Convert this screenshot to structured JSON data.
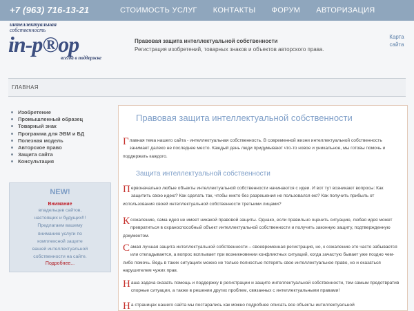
{
  "header": {
    "phone": "+7 (963) 716-13-21",
    "nav": [
      "СТОИМОСТЬ УСЛУГ",
      "КОНТАКТЫ",
      "ФОРУМ",
      "АВТОРИЗАЦИЯ"
    ]
  },
  "logo": {
    "line1": "интеллектуальная",
    "line2": "собственность",
    "main": "in-p®op",
    "slogan": "всегда в поддержке"
  },
  "site": {
    "title": "Правовая защита интеллектуальной собственности",
    "subtitle": "Регистрация изобретений, товарных знаков и объектов авторского права.",
    "sitemap_1": "Карта",
    "sitemap_2": "сайта"
  },
  "breadcrumb": "ГЛАВНАЯ",
  "sidebar": {
    "items": [
      "Изобретение",
      "Промышленный образец",
      "Товарный знак",
      "Программа для ЭВМ и БД",
      "Полезная модель",
      "Авторское право",
      "Защита сайта",
      "Консультация"
    ],
    "new_box": {
      "title": "NEW!",
      "attention": "Внимание",
      "lines": [
        "владельцев сайтов,",
        "настоящих и будущих!!!",
        "Предлагаем вашему",
        "вниманию услуги по",
        "комплексной защите",
        "вашей интеллектуальной",
        "собственности на сайте."
      ],
      "more": "Подробнее..."
    }
  },
  "content": {
    "title": "Правовая защита интеллектуальной собственности",
    "subtitle": "Защита интеллектуальной собственности",
    "paragraphs": [
      {
        "dc": "Г",
        "text": "лавная тема нашего сайта - интеллектуальная собственность. В современной жизни интеллектуальной собственность занимает далеко не последнее место. Каждый день люди придумывают что-то новое и уникальное, мы готовы помочь и поддержать каждого."
      },
      {
        "dc": "П",
        "text": "ервоначально любые объекты интеллектуальной собственности начинаются с идеи. И вот тут возникают вопросы: Как защитить свою идею? Как сделать так, чтобы никто без разрешения не пользовался ею? Как получить прибыль от использования своей интеллектуальной собственности третьими лицами?"
      },
      {
        "dc": "К",
        "text": "сожалению, сама идея не имеет никакой правовой защиты. Однако, если правильно оценить ситуацию, любая идея может превратиться в охраноспособный объект интеллектуальной собственности и получить законную защиту, подтвержденную документом."
      },
      {
        "dc": "С",
        "text": "амая лучшая защита интеллектуальной собственности – своевременная регистрация, но, к сожалению это часто забывается или откладывается, а вопрос всплывает при возникновении конфликтных ситуаций, когда зачастую бывает уже поздно чем-либо помочь. Ведь в таких ситуациях можно не только полностью потерять свое интеллектуальное право, но и оказаться нарушителем чужих прав."
      },
      {
        "dc": "Н",
        "text": "аша задача оказать помощь и поддержку в регистрации и защите интеллектуальной собственности, тем самым предотвратив спорные ситуации, а также в решении других проблем, связанных с интеллектуальными правами!"
      },
      {
        "dc": "Н",
        "text": "а страницах нашего сайта мы постарались как можно подробнее описать все объекты интеллектуальной"
      }
    ]
  }
}
